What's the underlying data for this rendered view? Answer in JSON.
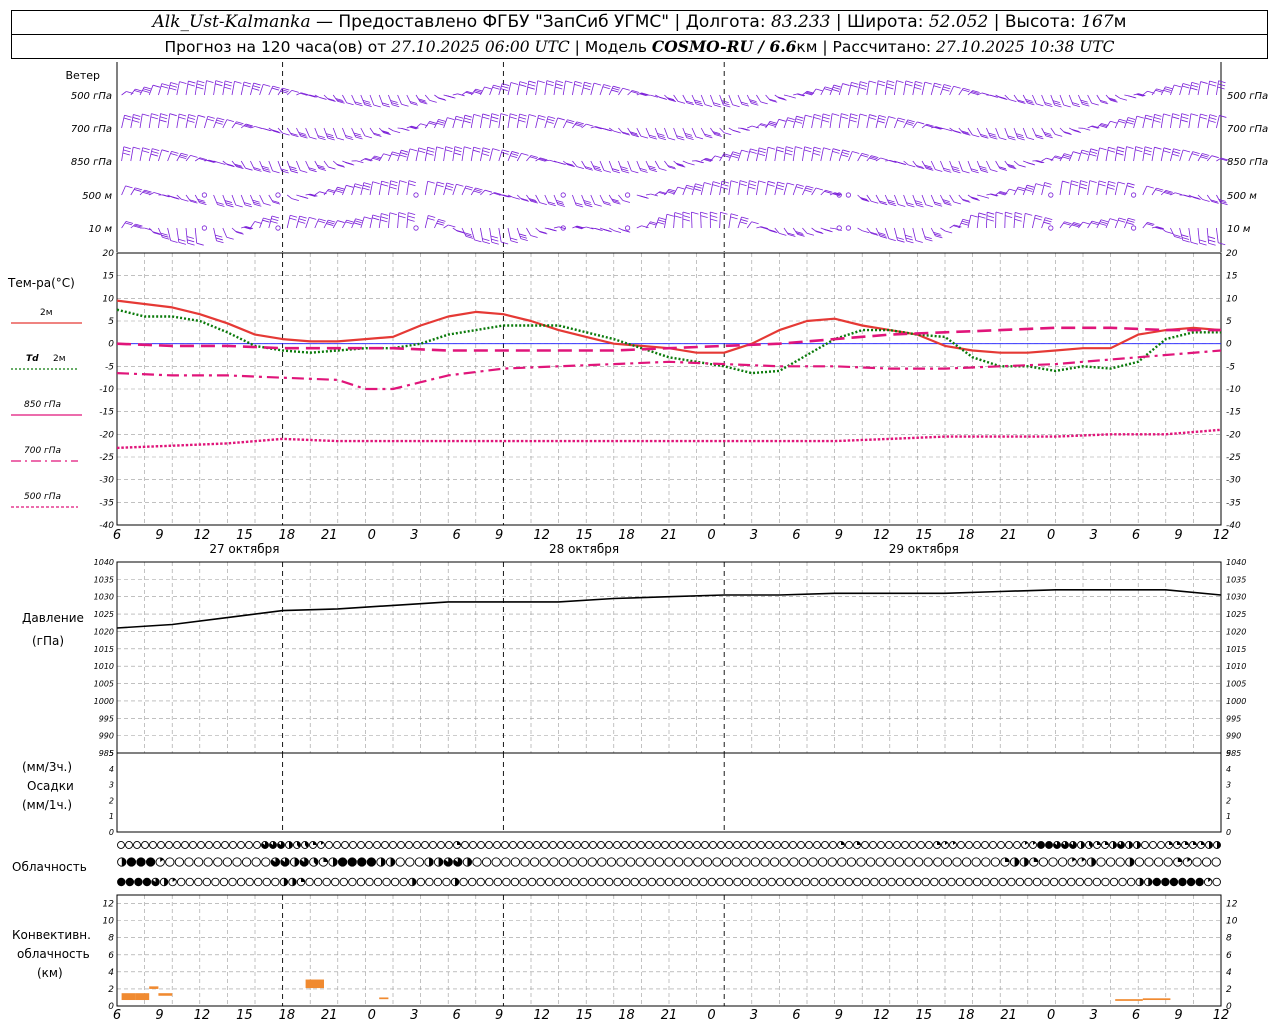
{
  "header": {
    "station": "Alk_Ust-Kalmanka",
    "provided_by": " — Предоставлено ФГБУ \"ЗапСиб УГМС\" | Долгота: ",
    "longitude": "83.233",
    "lat_label": " | Широта: ",
    "latitude": "52.052",
    "alt_label": " | Высота: ",
    "altitude": "167",
    "alt_unit": "м",
    "forecast_label": "Прогноз на 120 часа(ов) от ",
    "forecast_start": "27.10.2025 06:00 UTC",
    "model_label": " | Модель ",
    "model": "COSMO-RU / 6.6",
    "model_unit": "км",
    "calc_label": " | Рассчитано: ",
    "calc_time": "27.10.2025 10:38 UTC"
  },
  "time_axis": {
    "hour_labels": [
      "6",
      "9",
      "12",
      "15",
      "18",
      "21",
      "0",
      "3",
      "6",
      "9",
      "12",
      "15",
      "18",
      "21",
      "0",
      "3",
      "6",
      "9",
      "12",
      "15",
      "18",
      "21",
      "0",
      "3",
      "6",
      "9",
      "12"
    ],
    "date_labels": [
      {
        "label": "27 октября",
        "hour_index": 3
      },
      {
        "label": "28 октября",
        "hour_index": 11
      },
      {
        "label": "29 октября",
        "hour_index": 19
      }
    ],
    "midnight_indices": [
      6,
      14,
      22
    ]
  },
  "colors": {
    "wind_barbs": "#7b1fd8",
    "t2m": "#e53935",
    "td2m": "#0a7a0a",
    "t850": "#e0157a",
    "t700": "#e0157a",
    "t500": "#e0157a",
    "zero_line": "#1a1aff",
    "pressure": "#000000",
    "convective": "#f08a30",
    "grid": "#9a9a9a"
  },
  "wind_panel": {
    "title": "Ветер",
    "levels": [
      "500 гПа",
      "700 гПа",
      "850 гПа",
      "500 м",
      "10 м"
    ]
  },
  "labels": {
    "temp_title": "Тем-ра(°С)",
    "t2m_legend": "2м",
    "td_legend_sym": "Td",
    "td_legend": "2м",
    "t850_legend": "850 гПа",
    "t700_legend": "700 гПа",
    "t500_legend": "500 гПа",
    "pressure_title": "Давление",
    "pressure_unit": "(гПа)",
    "precip_unit1": "(мм/3ч.)",
    "precip_title": "Осадки",
    "precip_unit2": "(мм/1ч.)",
    "cloud_title": "Облачность",
    "conv_title1": "Конвективн.",
    "conv_title2": "облачность",
    "conv_unit": "(км)"
  },
  "chart_data": [
    {
      "type": "line",
      "name": "temperature",
      "x_unit": "hours from 27.10.2025 06 UTC",
      "ylim": [
        -40,
        20
      ],
      "yticks": [
        20,
        15,
        10,
        5,
        0,
        -5,
        -10,
        -15,
        -20,
        -25,
        -30,
        -35,
        -40
      ],
      "grid": true,
      "series": [
        {
          "name": "2м",
          "style": "solid",
          "x": [
            0,
            6,
            9,
            12,
            15,
            18,
            21,
            24,
            27,
            30,
            33,
            36,
            39,
            42,
            45,
            48,
            51,
            54,
            57,
            60,
            63,
            66,
            69,
            72,
            75,
            78,
            81,
            84,
            87,
            90,
            93,
            96,
            99,
            102,
            105,
            108,
            111,
            114,
            117,
            120
          ],
          "y": [
            9.5,
            8,
            6.5,
            4.5,
            2,
            1,
            0.5,
            0.5,
            1,
            1.5,
            4,
            6,
            7,
            6.5,
            5,
            3,
            1.5,
            0,
            -0.5,
            -1,
            -2,
            -2,
            0,
            3,
            5,
            5.5,
            4,
            3,
            2,
            -0.5,
            -1.5,
            -2,
            -2,
            -1.5,
            -1,
            -1,
            2,
            3,
            3.5,
            3
          ]
        },
        {
          "name": "Td 2м",
          "style": "dotted",
          "x": [
            0,
            3,
            6,
            9,
            12,
            15,
            18,
            21,
            24,
            27,
            30,
            33,
            36,
            39,
            42,
            45,
            48,
            51,
            54,
            57,
            60,
            63,
            66,
            69,
            72,
            75,
            78,
            81,
            84,
            87,
            90,
            93,
            96,
            99,
            102,
            105,
            108,
            111,
            114,
            117,
            120
          ],
          "y": [
            7.5,
            6,
            6,
            5,
            2.5,
            -0.5,
            -1.5,
            -2,
            -1.5,
            -1,
            -1,
            0,
            2,
            3,
            4,
            4,
            4,
            2.5,
            1,
            -1,
            -3,
            -4,
            -5,
            -6.5,
            -6,
            -2.5,
            1,
            3,
            3,
            2,
            1.5,
            -3,
            -5,
            -5,
            -6,
            -5,
            -5.5,
            -4,
            1,
            2.5,
            2.5
          ]
        },
        {
          "name": "850 гПа",
          "style": "longdash",
          "x": [
            0,
            6,
            12,
            18,
            24,
            30,
            36,
            42,
            48,
            54,
            60,
            66,
            72,
            78,
            84,
            90,
            96,
            102,
            108,
            114,
            120
          ],
          "y": [
            0,
            -0.5,
            -0.5,
            -1,
            -1,
            -1,
            -1.5,
            -1.5,
            -1.5,
            -1.5,
            -1,
            -0.5,
            0,
            1,
            2,
            2.5,
            3,
            3.5,
            3.5,
            3,
            3
          ]
        },
        {
          "name": "700 гПа",
          "style": "dashdot",
          "x": [
            0,
            6,
            12,
            18,
            24,
            27,
            30,
            33,
            36,
            42,
            48,
            54,
            60,
            66,
            72,
            78,
            84,
            90,
            96,
            102,
            108,
            114,
            120
          ],
          "y": [
            -6.5,
            -7,
            -7,
            -7.5,
            -8,
            -10,
            -10,
            -8.5,
            -7,
            -5.5,
            -5,
            -4.5,
            -4,
            -4.5,
            -5,
            -5,
            -5.5,
            -5.5,
            -5,
            -4.5,
            -3.5,
            -2.5,
            -1.5
          ]
        },
        {
          "name": "500 гПа",
          "style": "dotted-dense",
          "x": [
            0,
            6,
            12,
            18,
            24,
            30,
            36,
            42,
            48,
            54,
            60,
            66,
            72,
            78,
            84,
            90,
            96,
            102,
            108,
            114,
            120
          ],
          "y": [
            -23,
            -22.5,
            -22,
            -21,
            -21.5,
            -21.5,
            -21.5,
            -21.5,
            -21.5,
            -21.5,
            -21.5,
            -21.5,
            -21.5,
            -21.5,
            -21,
            -20.5,
            -20.5,
            -20.5,
            -20,
            -20,
            -19
          ]
        }
      ]
    },
    {
      "type": "line",
      "name": "pressure",
      "title": "Давление",
      "ylabel": "(гПа)",
      "ylim": [
        985,
        1040
      ],
      "yticks": [
        1040,
        1035,
        1030,
        1025,
        1020,
        1015,
        1010,
        1005,
        1000,
        995,
        990,
        985
      ],
      "grid": true,
      "series": [
        {
          "x": [
            0,
            6,
            12,
            18,
            24,
            30,
            36,
            42,
            48,
            54,
            60,
            66,
            72,
            78,
            84,
            90,
            96,
            102,
            108,
            114,
            120
          ],
          "y": [
            1021,
            1022,
            1024,
            1026,
            1026.5,
            1027.5,
            1028.5,
            1028.5,
            1028.5,
            1029.5,
            1030,
            1030.5,
            1030.5,
            1031,
            1031,
            1031,
            1031.5,
            1032,
            1032,
            1032,
            1030.5
          ]
        }
      ]
    },
    {
      "type": "bar",
      "name": "precipitation",
      "title": "Осадки",
      "ylim": [
        0,
        5
      ],
      "yticks": [
        5,
        4,
        3,
        2,
        1,
        0
      ],
      "values": []
    },
    {
      "type": "table",
      "name": "cloud_cover",
      "title": "Облачность",
      "rows": [
        {
          "tier": "upper",
          "values": [
            0,
            0,
            0,
            0,
            0,
            0,
            0,
            0,
            0,
            0,
            0,
            0,
            0,
            0,
            0,
            0,
            0,
            0,
            0.85,
            0.85,
            0.85,
            0.5,
            0.4,
            0.4,
            0.25,
            0.15,
            0,
            0,
            0,
            0,
            0,
            0,
            0,
            0,
            0,
            0,
            0,
            0,
            0,
            0,
            0,
            0,
            0.25,
            0,
            0,
            0,
            0,
            0,
            0,
            0,
            0,
            0,
            0,
            0,
            0,
            0,
            0,
            0,
            0,
            0,
            0,
            0,
            0,
            0,
            0,
            0,
            0,
            0,
            0,
            0,
            0,
            0,
            0,
            0,
            0,
            0,
            0,
            0,
            0,
            0,
            0,
            0,
            0,
            0,
            0,
            0,
            0,
            0,
            0,
            0,
            0.25,
            0,
            0.25,
            0,
            0,
            0,
            0,
            0,
            0,
            0,
            0,
            0,
            0.25,
            0.15,
            0.15,
            0,
            0,
            0,
            0,
            0,
            0,
            0,
            0,
            0.15,
            0.15,
            1,
            1,
            0.85,
            0.85,
            0.85,
            0.5,
            0.4,
            0.25,
            0.25,
            0.5,
            0.85,
            0.5,
            0.5,
            0,
            0,
            0,
            0.25,
            0.25,
            0.25,
            0.25,
            0.25,
            0.5,
            0.5
          ]
        },
        {
          "tier": "middle",
          "values": [
            0.5,
            1,
            1,
            1,
            0.15,
            0,
            0,
            0,
            0,
            0,
            0,
            0,
            0,
            0,
            0,
            0,
            0.85,
            0.85,
            0.5,
            0.85,
            0.4,
            0.25,
            0.5,
            1,
            1,
            1,
            1,
            0.5,
            0.5,
            0,
            0,
            0,
            0.5,
            0.5,
            0.85,
            0.85,
            0.5,
            0,
            0,
            0,
            0,
            0,
            0,
            0,
            0,
            0,
            0,
            0,
            0,
            0,
            0,
            0,
            0,
            0,
            0,
            0,
            0,
            0,
            0,
            0,
            0,
            0,
            0,
            0,
            0,
            0,
            0,
            0,
            0,
            0,
            0,
            0,
            0,
            0,
            0,
            0,
            0,
            0,
            0,
            0,
            0,
            0,
            0,
            0,
            0,
            0,
            0,
            0,
            0,
            0,
            0,
            0,
            0.25,
            0.5,
            0.5,
            0.25,
            0,
            0,
            0,
            0.15,
            0.15,
            0.5,
            0,
            0,
            0,
            0.5,
            0,
            0,
            0,
            0,
            0.25,
            0.15,
            0,
            0,
            0
          ]
        },
        {
          "tier": "lower",
          "values": [
            1,
            1,
            1,
            1,
            0.85,
            0.5,
            0.15,
            0,
            0,
            0,
            0,
            0,
            0,
            0,
            0,
            0,
            0,
            0,
            0,
            0.5,
            0.5,
            0.25,
            0,
            0,
            0,
            0,
            0,
            0,
            0,
            0,
            0,
            0,
            0,
            0,
            0.5,
            0,
            0,
            0,
            0,
            0.5,
            0,
            0,
            0,
            0,
            0,
            0,
            0,
            0,
            0,
            0,
            0,
            0,
            0,
            0,
            0,
            0,
            0,
            0,
            0,
            0,
            0,
            0,
            0,
            0,
            0,
            0,
            0,
            0,
            0,
            0,
            0,
            0,
            0,
            0,
            0,
            0,
            0,
            0,
            0,
            0,
            0,
            0,
            0,
            0,
            0,
            0,
            0,
            0,
            0,
            0,
            0,
            0,
            0,
            0,
            0,
            0,
            0,
            0,
            0,
            0,
            0,
            0,
            0,
            0,
            0,
            0,
            0,
            0,
            0,
            0,
            0,
            0,
            0,
            0,
            0,
            0,
            0,
            0,
            0,
            0.5,
            0.5,
            1,
            1,
            1,
            1,
            1,
            1,
            0.15,
            0
          ]
        }
      ]
    },
    {
      "type": "bar",
      "name": "convective_cloud",
      "ylim": [
        0,
        13
      ],
      "yticks": [
        12,
        10,
        8,
        6,
        4,
        2,
        0
      ],
      "bars": [
        {
          "x0": 0.5,
          "x1": 2,
          "bottom": 0.7,
          "top": 1.5
        },
        {
          "x0": 2,
          "x1": 3.5,
          "bottom": 0.7,
          "top": 1.5
        },
        {
          "x0": 3.5,
          "x1": 4.5,
          "bottom": 2,
          "top": 2.3
        },
        {
          "x0": 4.5,
          "x1": 6,
          "bottom": 1.2,
          "top": 1.5
        },
        {
          "x0": 20.5,
          "x1": 22.5,
          "bottom": 2.1,
          "top": 3.1
        },
        {
          "x0": 28.5,
          "x1": 29.5,
          "bottom": 0.8,
          "top": 1
        },
        {
          "x0": 108.5,
          "x1": 111.5,
          "bottom": 0.6,
          "top": 0.8
        },
        {
          "x0": 111.5,
          "x1": 114.5,
          "bottom": 0.7,
          "top": 0.9
        }
      ]
    }
  ]
}
